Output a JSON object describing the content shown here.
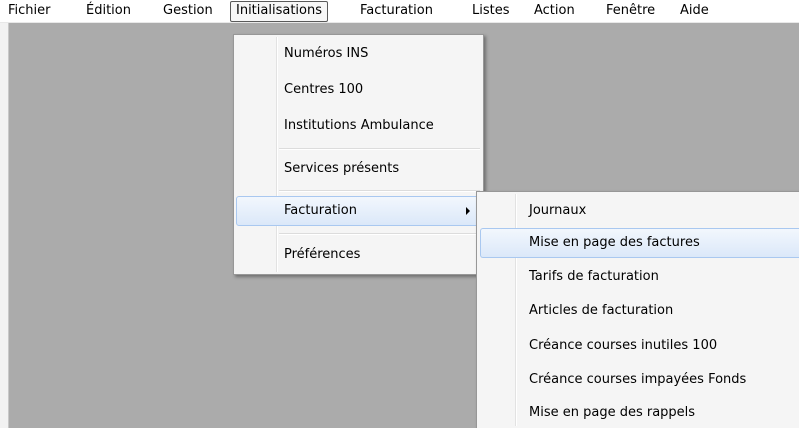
{
  "menubar": {
    "items": [
      "Fichier",
      "Édition",
      "Gestion",
      "Initialisations",
      "Facturation",
      "Listes",
      "Action",
      "Fenêtre",
      "Aide"
    ],
    "open_index": 3
  },
  "initialisations_menu": {
    "items": [
      {
        "label": "Numéros INS"
      },
      {
        "label": "Centres 100"
      },
      {
        "label": "Institutions Ambulance"
      },
      {
        "label": "Services présents"
      },
      {
        "label": "Facturation",
        "has_submenu": true,
        "highlighted": true
      },
      {
        "label": "Préférences"
      }
    ]
  },
  "facturation_submenu": {
    "items": [
      {
        "label": "Journaux"
      },
      {
        "label": "Mise en page des factures",
        "highlighted": true
      },
      {
        "label": "Tarifs de facturation"
      },
      {
        "label": "Articles de facturation"
      },
      {
        "label": "Créance courses inutiles 100"
      },
      {
        "label": "Créance courses impayées Fonds"
      },
      {
        "label": "Mise en page des rappels"
      }
    ]
  },
  "colors": {
    "workspace": "#ababab",
    "menu_bg": "#f5f5f5",
    "highlight_border": "#a9c8f0",
    "highlight_bg": "#dbe8f9"
  }
}
